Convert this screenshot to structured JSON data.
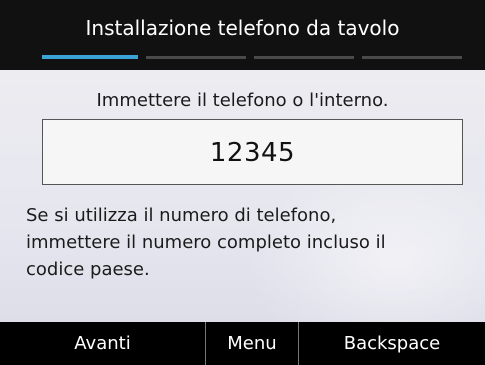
{
  "header": {
    "title": "Installazione telefono da tavolo",
    "progress_steps": 4,
    "active_step": 1,
    "accent_color": "#3aa3d8"
  },
  "main": {
    "prompt": "Immettere il telefono o l'interno.",
    "input_value": "12345",
    "help_lines": [
      "Se si utilizza il numero di telefono,",
      "immettere il numero completo incluso il",
      "codice paese."
    ]
  },
  "softkeys": [
    {
      "label": "Avanti"
    },
    {
      "label": "Menu"
    },
    {
      "label": "Backspace"
    }
  ]
}
